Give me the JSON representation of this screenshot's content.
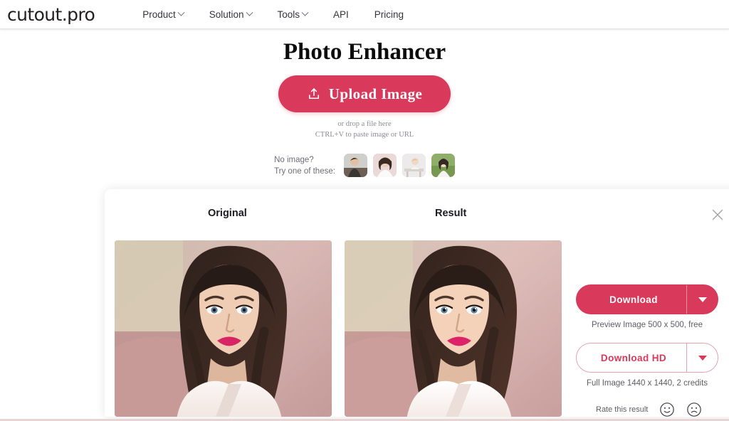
{
  "header": {
    "logo": "cutout.pro",
    "nav": [
      {
        "label": "Product",
        "has_caret": true,
        "name": "nav-item-product"
      },
      {
        "label": "Solution",
        "has_caret": true,
        "name": "nav-item-solution"
      },
      {
        "label": "Tools",
        "has_caret": true,
        "name": "nav-item-tools"
      },
      {
        "label": "API",
        "has_caret": false,
        "name": "nav-item-api"
      },
      {
        "label": "Pricing",
        "has_caret": false,
        "name": "nav-item-pricing"
      }
    ]
  },
  "hero": {
    "title": "Photo Enhancer",
    "upload_button": "Upload Image",
    "upload_icon": "upload-icon",
    "drop_hint_line1": "or drop a file here",
    "drop_hint_line2": "CTRL+V to paste image or URL"
  },
  "samples": {
    "label_line1": "No image?",
    "label_line2": "Try one of these:",
    "thumbnails": [
      {
        "name": "sample-thumbnail-1",
        "alt": "man in dark jacket"
      },
      {
        "name": "sample-thumbnail-2",
        "alt": "woman in white top"
      },
      {
        "name": "sample-thumbnail-3",
        "alt": "child at table"
      },
      {
        "name": "sample-thumbnail-4",
        "alt": "woman outdoors in green"
      }
    ]
  },
  "result_card": {
    "original_label": "Original",
    "result_label": "Result",
    "close_icon": "close-icon",
    "original_image_alt": "portrait of woman with dark hair, original",
    "result_image_alt": "portrait of woman with dark hair, enhanced result",
    "actions": {
      "download_label": "Download",
      "download_note": "Preview Image 500 x 500, free",
      "download_hd_label": "Download HD",
      "download_hd_note": "Full Image 1440 x 1440, 2 credits",
      "dropdown_icon": "chevron-down-icon",
      "rate_label": "Rate this result",
      "rate_positive_icon": "smiley-face-icon",
      "rate_negative_icon": "frowny-face-icon"
    }
  },
  "colors": {
    "accent": "#d9395a",
    "accent_border": "#e6a2b3",
    "text_dark": "#1c1c21",
    "text_muted": "#5d5e66",
    "page_bg": "#ffffff"
  }
}
